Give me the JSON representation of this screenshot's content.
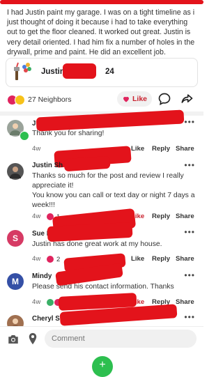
{
  "post": {
    "body": "I had Justin paint my garage. I was on a tight timeline as i just thought of doing it because i had to take everything out to get the floor cleaned.  It worked out great. Justin is very detail oriented. I had him fix a number of holes in the drywall, prime and paint.  He did an excellent job.",
    "business_name": "Justin",
    "business_rating": "24"
  },
  "reactions": {
    "count": "27 Neighbors"
  },
  "actions": {
    "like_label": "Like"
  },
  "comments": [
    {
      "name": "J",
      "body": "Thank you for sharing!",
      "time": "4w",
      "reaction_count": "",
      "like": "Like",
      "reply": "Reply",
      "share": "Share"
    },
    {
      "name": "Justin Sh",
      "body": "Thanks so much for the post and review I really appreciate it!\nYou know you can call or text day or night 7 days a week!!!",
      "time": "4w",
      "reaction_count": "1",
      "like": "Like",
      "reply": "Reply",
      "share": "Share"
    },
    {
      "name": "Sue Fi",
      "initial": "S",
      "body": "Justin has done great work at my house.",
      "time": "4w",
      "reaction_count": "2",
      "like": "Like",
      "reply": "Reply",
      "share": "Share"
    },
    {
      "name": "Mindy",
      "initial": "M",
      "body": "Please send his contact information. Thanks",
      "time": "4w",
      "reaction_count": "2",
      "like": "Like",
      "reply": "Reply",
      "share": "Share"
    },
    {
      "name": "Cheryl S"
    }
  ],
  "composer": {
    "placeholder": "Comment"
  },
  "colors": {
    "accent_red": "#c9212e",
    "brand_green": "#2dbf4f",
    "avatar_s": "#d63a64",
    "avatar_m": "#3550a6"
  }
}
